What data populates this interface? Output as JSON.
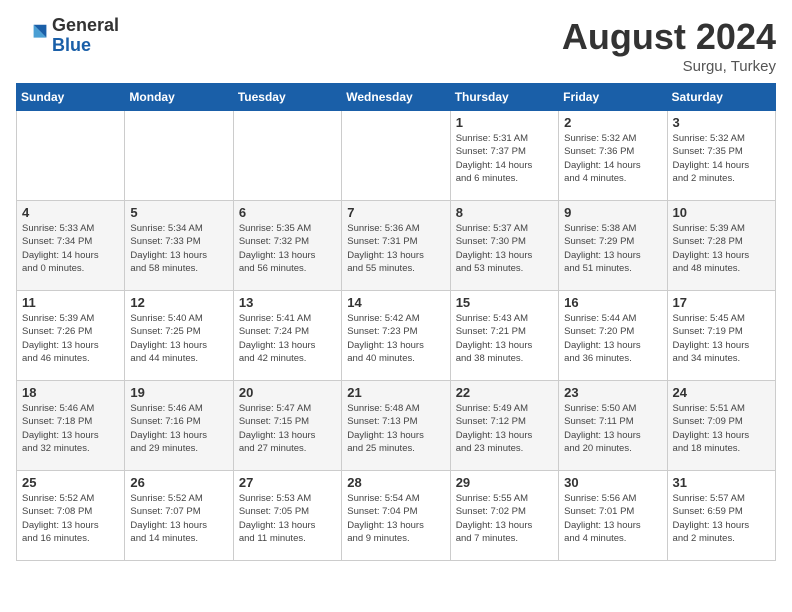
{
  "logo": {
    "general": "General",
    "blue": "Blue"
  },
  "title": "August 2024",
  "location": "Surgu, Turkey",
  "days_header": [
    "Sunday",
    "Monday",
    "Tuesday",
    "Wednesday",
    "Thursday",
    "Friday",
    "Saturday"
  ],
  "weeks": [
    [
      {
        "num": "",
        "info": ""
      },
      {
        "num": "",
        "info": ""
      },
      {
        "num": "",
        "info": ""
      },
      {
        "num": "",
        "info": ""
      },
      {
        "num": "1",
        "info": "Sunrise: 5:31 AM\nSunset: 7:37 PM\nDaylight: 14 hours\nand 6 minutes."
      },
      {
        "num": "2",
        "info": "Sunrise: 5:32 AM\nSunset: 7:36 PM\nDaylight: 14 hours\nand 4 minutes."
      },
      {
        "num": "3",
        "info": "Sunrise: 5:32 AM\nSunset: 7:35 PM\nDaylight: 14 hours\nand 2 minutes."
      }
    ],
    [
      {
        "num": "4",
        "info": "Sunrise: 5:33 AM\nSunset: 7:34 PM\nDaylight: 14 hours\nand 0 minutes."
      },
      {
        "num": "5",
        "info": "Sunrise: 5:34 AM\nSunset: 7:33 PM\nDaylight: 13 hours\nand 58 minutes."
      },
      {
        "num": "6",
        "info": "Sunrise: 5:35 AM\nSunset: 7:32 PM\nDaylight: 13 hours\nand 56 minutes."
      },
      {
        "num": "7",
        "info": "Sunrise: 5:36 AM\nSunset: 7:31 PM\nDaylight: 13 hours\nand 55 minutes."
      },
      {
        "num": "8",
        "info": "Sunrise: 5:37 AM\nSunset: 7:30 PM\nDaylight: 13 hours\nand 53 minutes."
      },
      {
        "num": "9",
        "info": "Sunrise: 5:38 AM\nSunset: 7:29 PM\nDaylight: 13 hours\nand 51 minutes."
      },
      {
        "num": "10",
        "info": "Sunrise: 5:39 AM\nSunset: 7:28 PM\nDaylight: 13 hours\nand 48 minutes."
      }
    ],
    [
      {
        "num": "11",
        "info": "Sunrise: 5:39 AM\nSunset: 7:26 PM\nDaylight: 13 hours\nand 46 minutes."
      },
      {
        "num": "12",
        "info": "Sunrise: 5:40 AM\nSunset: 7:25 PM\nDaylight: 13 hours\nand 44 minutes."
      },
      {
        "num": "13",
        "info": "Sunrise: 5:41 AM\nSunset: 7:24 PM\nDaylight: 13 hours\nand 42 minutes."
      },
      {
        "num": "14",
        "info": "Sunrise: 5:42 AM\nSunset: 7:23 PM\nDaylight: 13 hours\nand 40 minutes."
      },
      {
        "num": "15",
        "info": "Sunrise: 5:43 AM\nSunset: 7:21 PM\nDaylight: 13 hours\nand 38 minutes."
      },
      {
        "num": "16",
        "info": "Sunrise: 5:44 AM\nSunset: 7:20 PM\nDaylight: 13 hours\nand 36 minutes."
      },
      {
        "num": "17",
        "info": "Sunrise: 5:45 AM\nSunset: 7:19 PM\nDaylight: 13 hours\nand 34 minutes."
      }
    ],
    [
      {
        "num": "18",
        "info": "Sunrise: 5:46 AM\nSunset: 7:18 PM\nDaylight: 13 hours\nand 32 minutes."
      },
      {
        "num": "19",
        "info": "Sunrise: 5:46 AM\nSunset: 7:16 PM\nDaylight: 13 hours\nand 29 minutes."
      },
      {
        "num": "20",
        "info": "Sunrise: 5:47 AM\nSunset: 7:15 PM\nDaylight: 13 hours\nand 27 minutes."
      },
      {
        "num": "21",
        "info": "Sunrise: 5:48 AM\nSunset: 7:13 PM\nDaylight: 13 hours\nand 25 minutes."
      },
      {
        "num": "22",
        "info": "Sunrise: 5:49 AM\nSunset: 7:12 PM\nDaylight: 13 hours\nand 23 minutes."
      },
      {
        "num": "23",
        "info": "Sunrise: 5:50 AM\nSunset: 7:11 PM\nDaylight: 13 hours\nand 20 minutes."
      },
      {
        "num": "24",
        "info": "Sunrise: 5:51 AM\nSunset: 7:09 PM\nDaylight: 13 hours\nand 18 minutes."
      }
    ],
    [
      {
        "num": "25",
        "info": "Sunrise: 5:52 AM\nSunset: 7:08 PM\nDaylight: 13 hours\nand 16 minutes."
      },
      {
        "num": "26",
        "info": "Sunrise: 5:52 AM\nSunset: 7:07 PM\nDaylight: 13 hours\nand 14 minutes."
      },
      {
        "num": "27",
        "info": "Sunrise: 5:53 AM\nSunset: 7:05 PM\nDaylight: 13 hours\nand 11 minutes."
      },
      {
        "num": "28",
        "info": "Sunrise: 5:54 AM\nSunset: 7:04 PM\nDaylight: 13 hours\nand 9 minutes."
      },
      {
        "num": "29",
        "info": "Sunrise: 5:55 AM\nSunset: 7:02 PM\nDaylight: 13 hours\nand 7 minutes."
      },
      {
        "num": "30",
        "info": "Sunrise: 5:56 AM\nSunset: 7:01 PM\nDaylight: 13 hours\nand 4 minutes."
      },
      {
        "num": "31",
        "info": "Sunrise: 5:57 AM\nSunset: 6:59 PM\nDaylight: 13 hours\nand 2 minutes."
      }
    ]
  ]
}
